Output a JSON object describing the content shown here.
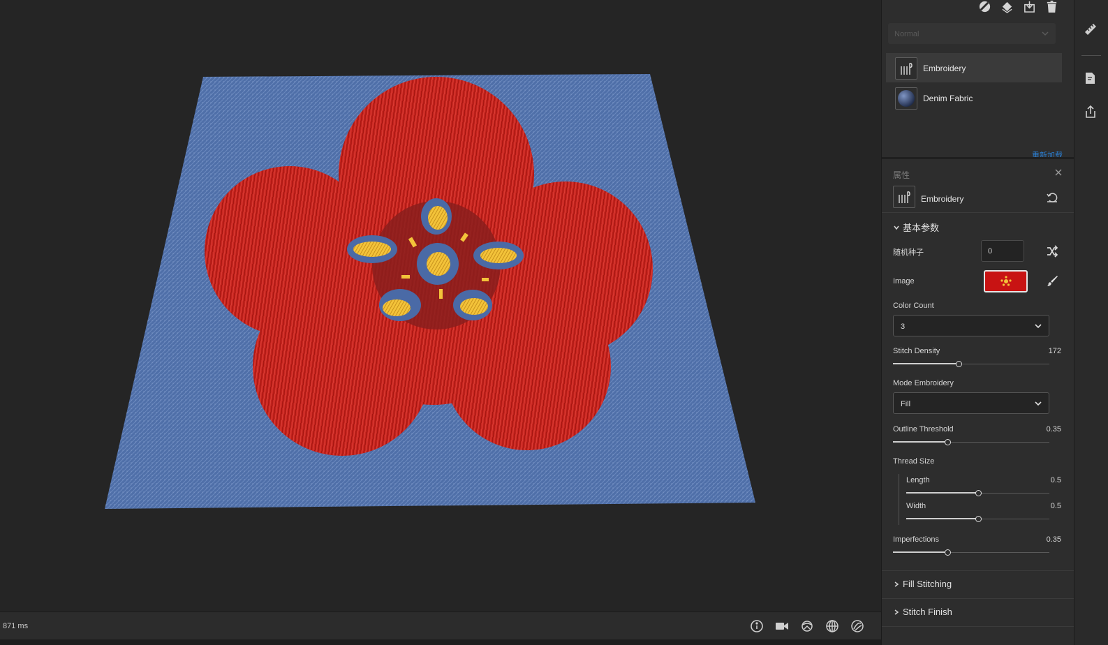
{
  "viewport": {
    "render_time": "871 ms",
    "tools": [
      "info-icon",
      "camera-icon",
      "environment-icon",
      "grid-icon",
      "shading-icon"
    ]
  },
  "layers_panel": {
    "blend_mode": "Normal",
    "layers": [
      {
        "name": "Embroidery",
        "selected": true,
        "icon": "embroidery-icon"
      },
      {
        "name": "Denim Fabric",
        "selected": false,
        "icon": "sphere-material-icon"
      }
    ],
    "reload_label": "重新加载"
  },
  "properties": {
    "header": "属性",
    "item_name": "Embroidery",
    "section_basic": "基本参数",
    "random_seed_label": "随机种子",
    "random_seed_value": "0",
    "image_label": "Image",
    "color_count_label": "Color Count",
    "color_count_value": "3",
    "stitch_density_label": "Stitch Density",
    "stitch_density_value": "172",
    "stitch_density_fraction": 0.42,
    "mode_label": "Mode Embroidery",
    "mode_value": "Fill",
    "outline_label": "Outline Threshold",
    "outline_value": "0.35",
    "outline_fraction": 0.35,
    "thread_size_label": "Thread Size",
    "length_label": "Length",
    "length_value": "0.5",
    "length_fraction": 0.5,
    "width_label": "Width",
    "width_value": "0.5",
    "width_fraction": 0.5,
    "imperfections_label": "Imperfections",
    "imperfections_value": "0.35",
    "imperfections_fraction": 0.35,
    "section_fill": "Fill Stitching",
    "section_finish": "Stitch Finish"
  },
  "colors": {
    "denim": "#4e6ea6",
    "petal_red": "#c9231e",
    "stamen_yellow": "#f2c035",
    "link_blue": "#2a7fd4"
  }
}
